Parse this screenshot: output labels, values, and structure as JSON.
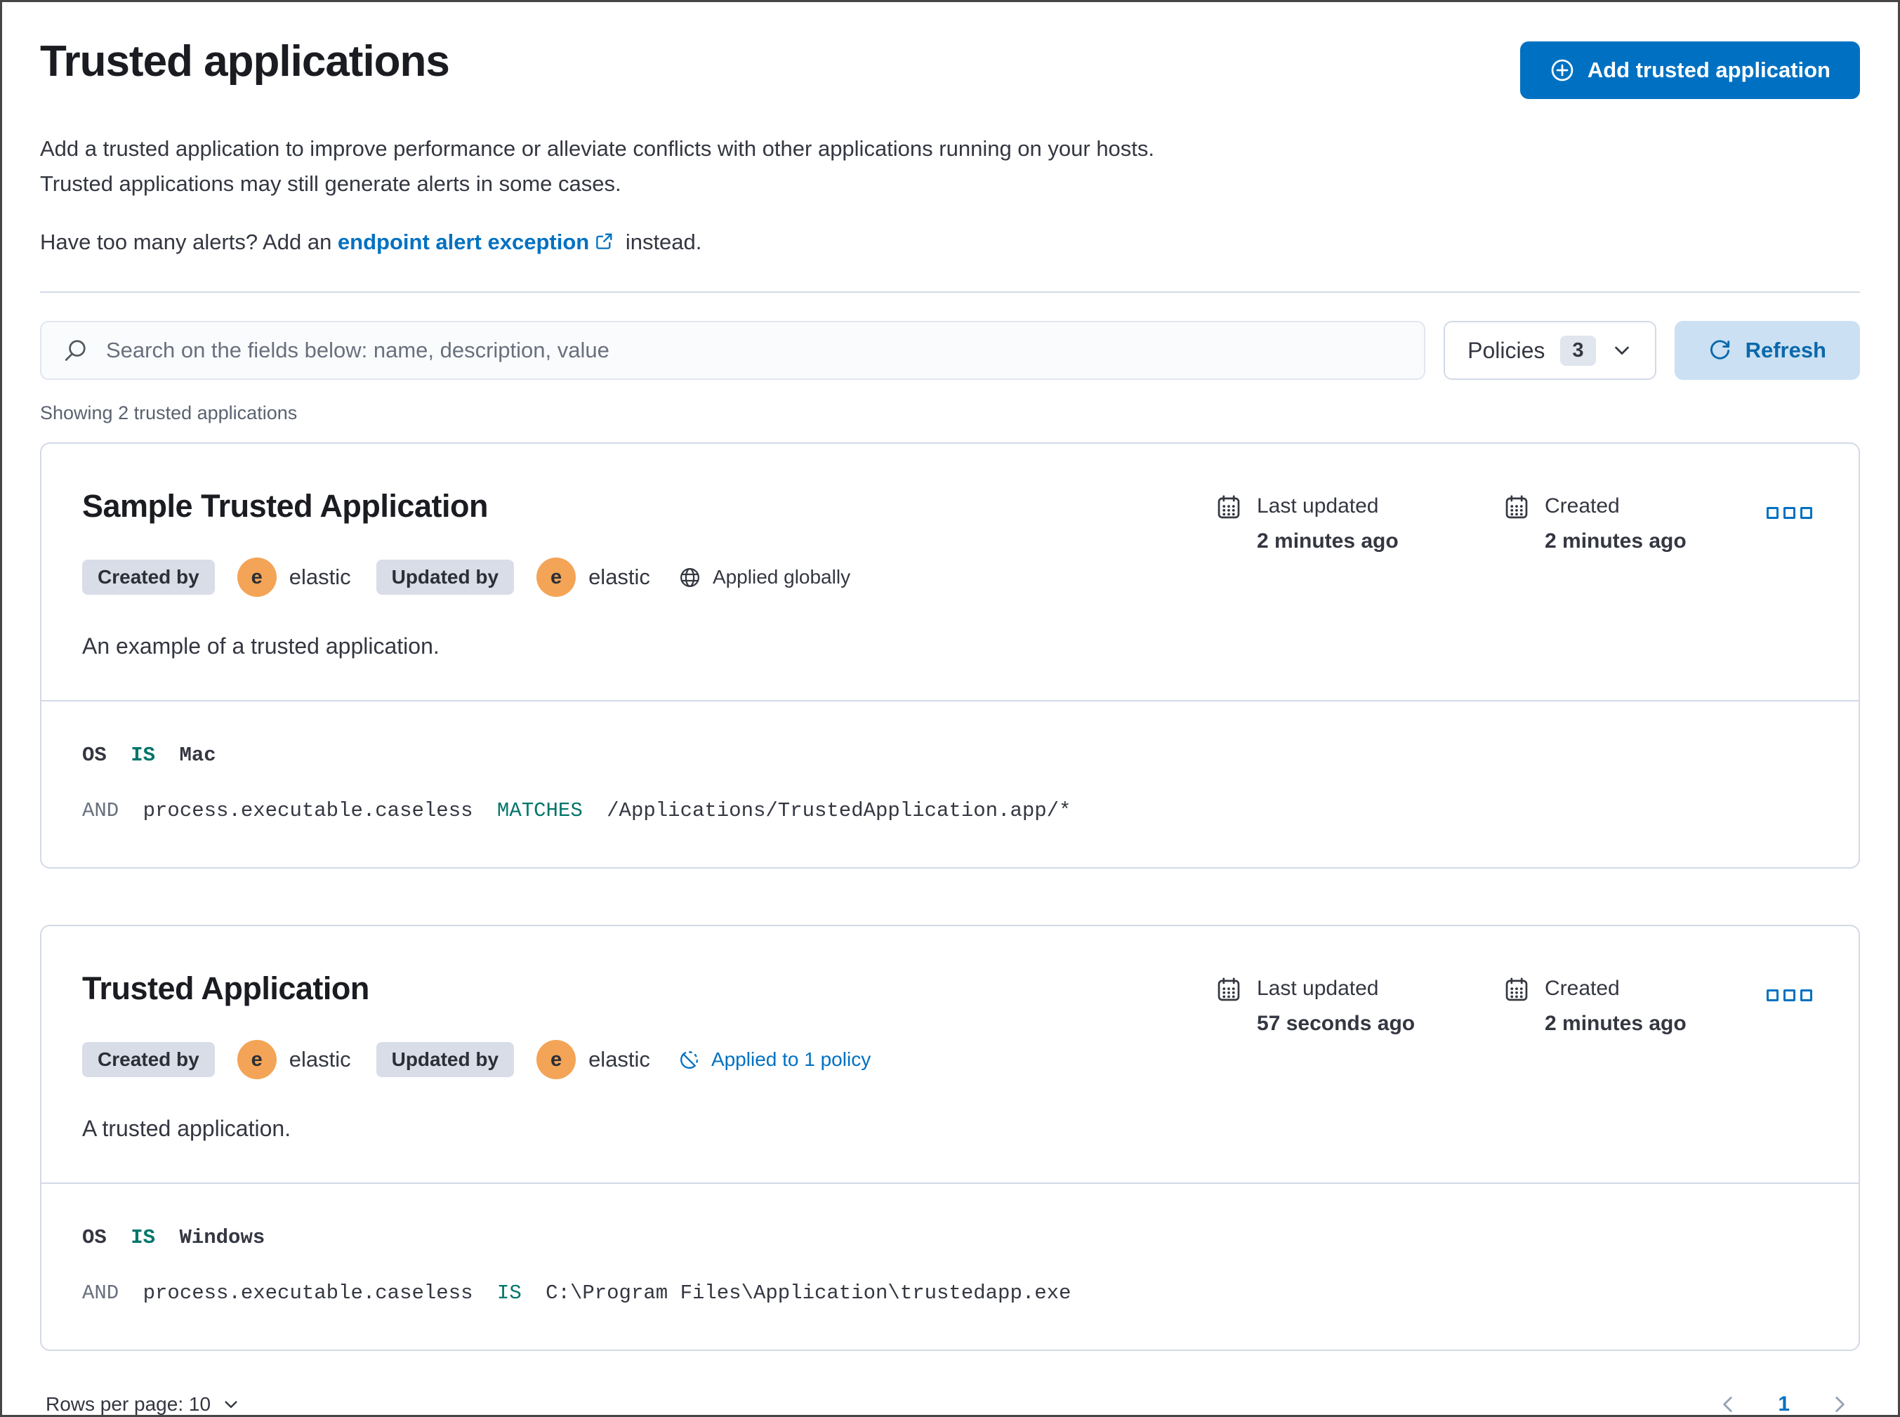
{
  "colors": {
    "primary_blue": "#0071c2",
    "refresh_bg": "#cbe0f2",
    "operator_teal": "#00756b",
    "badge_bg": "#d8dde8",
    "avatar_orange": "#f3a456",
    "text": "#343741",
    "subdued_text": "#69707d",
    "border": "#d3dae6"
  },
  "page": {
    "title": "Trusted applications",
    "intro": "Add a trusted application to improve performance or alleviate conflicts with other applications running on your hosts. Trusted applications may still generate alerts in some cases.",
    "alerts_prompt_prefix": "Have too many alerts? Add an ",
    "alerts_link": "endpoint alert exception",
    "alerts_prompt_suffix": " instead.",
    "add_button": "Add trusted application",
    "search_placeholder": "Search on the fields below: name, description, value",
    "policies_label": "Policies",
    "policies_count": "3",
    "refresh_label": "Refresh",
    "results_count": "Showing 2 trusted applications"
  },
  "cards": [
    {
      "title": "Sample Trusted Application",
      "created_by_label": "Created by",
      "created_by_avatar": "e",
      "created_by_user": "elastic",
      "updated_by_label": "Updated by",
      "updated_by_avatar": "e",
      "updated_by_user": "elastic",
      "scope_label": "Applied globally",
      "description": "An example of a trusted application.",
      "last_updated_label": "Last updated",
      "last_updated_value": "2 minutes ago",
      "created_label": "Created",
      "created_value": "2 minutes ago",
      "condition": {
        "field1": "OS",
        "op1": "IS",
        "value1": "Mac",
        "conjunction": "AND",
        "field2": "process.executable.caseless",
        "op2": "MATCHES",
        "value2": "/Applications/TrustedApplication.app/*"
      }
    },
    {
      "title": "Trusted Application",
      "created_by_label": "Created by",
      "created_by_avatar": "e",
      "created_by_user": "elastic",
      "updated_by_label": "Updated by",
      "updated_by_avatar": "e",
      "updated_by_user": "elastic",
      "scope_label": "Applied to 1 policy",
      "description": "A trusted application.",
      "last_updated_label": "Last updated",
      "last_updated_value": "57 seconds ago",
      "created_label": "Created",
      "created_value": "2 minutes ago",
      "condition": {
        "field1": "OS",
        "op1": "IS",
        "value1": "Windows",
        "conjunction": "AND",
        "field2": "process.executable.caseless",
        "op2": "IS",
        "value2": "C:\\Program Files\\Application\\trustedapp.exe"
      }
    }
  ],
  "footer": {
    "rows_per_page": "Rows per page: 10",
    "page_number": "1"
  }
}
